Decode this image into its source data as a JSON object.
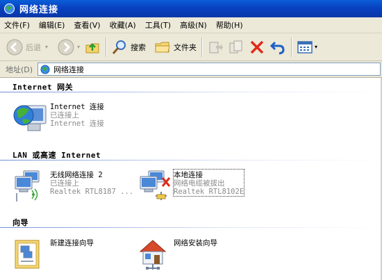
{
  "window": {
    "title": "网络连接",
    "icon": "network-connections-icon"
  },
  "menu": [
    "文件(F)",
    "编辑(E)",
    "查看(V)",
    "收藏(A)",
    "工具(T)",
    "高级(N)",
    "帮助(H)"
  ],
  "toolbar": {
    "back_label": "后退",
    "search_label": "搜索",
    "folders_label": "文件夹"
  },
  "address": {
    "label": "地址(D)",
    "value": "网络连接"
  },
  "groups": {
    "internet_gateway": "Internet 网关",
    "lan": "LAN 或高速 Internet",
    "wizard": "向导"
  },
  "items": {
    "internet_conn": {
      "name": "Internet 连接",
      "status": "已连接上",
      "desc": "Internet 连接"
    },
    "wireless": {
      "name": "无线网络连接 2",
      "status": "已连接上",
      "desc": "Realtek RTL8187 ..."
    },
    "local": {
      "name": "本地连接",
      "status": "网络电缆被拔出",
      "desc": "Realtek RTL8102E"
    },
    "new_conn_wizard": {
      "name": "新建连接向导"
    },
    "network_setup_wizard": {
      "name": "网络安装向导"
    }
  },
  "colors": {
    "title_blue": "#0a5fd8",
    "chrome": "#ece9d8",
    "group_line": "#6f8fd6"
  }
}
